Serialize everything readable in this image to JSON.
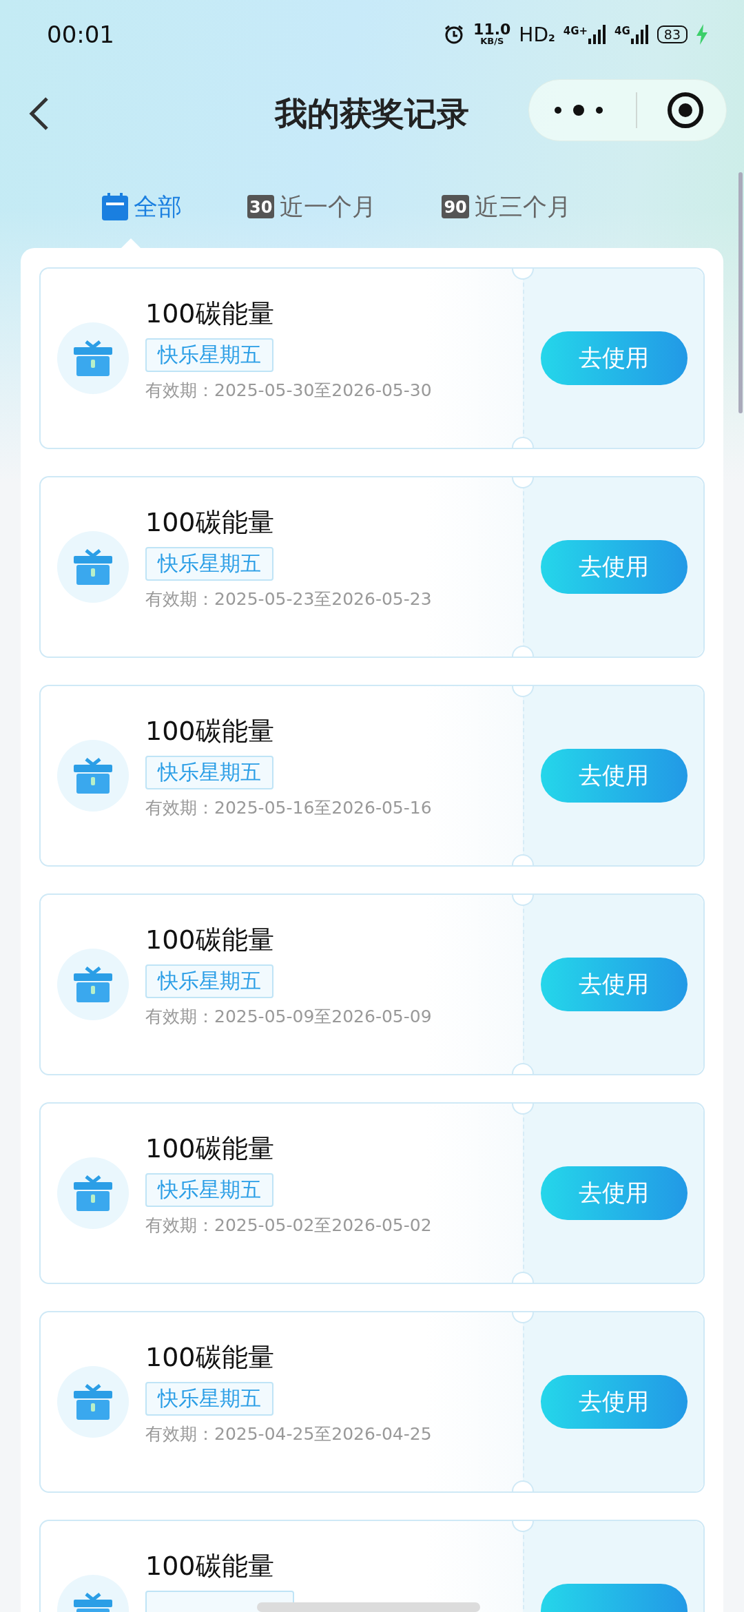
{
  "status_bar": {
    "time": "00:01",
    "speed": "11.0",
    "speed_unit": "KB/S",
    "hd": "HD",
    "sim": "2",
    "signals": [
      "4G+",
      "4G"
    ],
    "battery": "83",
    "charging": true
  },
  "header": {
    "title": "我的获奖记录"
  },
  "tabs": [
    {
      "label": "全部",
      "selected": true
    },
    {
      "label": "近一个月",
      "badge": "30",
      "selected": false
    },
    {
      "label": "近三个月",
      "badge": "90",
      "selected": false
    }
  ],
  "records": [
    {
      "title": "100碳能量",
      "tag": "快乐星期五",
      "validity": "有效期：2025-05-30至2026-05-30",
      "button": "去使用"
    },
    {
      "title": "100碳能量",
      "tag": "快乐星期五",
      "validity": "有效期：2025-05-23至2026-05-23",
      "button": "去使用"
    },
    {
      "title": "100碳能量",
      "tag": "快乐星期五",
      "validity": "有效期：2025-05-16至2026-05-16",
      "button": "去使用"
    },
    {
      "title": "100碳能量",
      "tag": "快乐星期五",
      "validity": "有效期：2025-05-09至2026-05-09",
      "button": "去使用"
    },
    {
      "title": "100碳能量",
      "tag": "快乐星期五",
      "validity": "有效期：2025-05-02至2026-05-02",
      "button": "去使用"
    },
    {
      "title": "100碳能量",
      "tag": "快乐星期五",
      "validity": "有效期：2025-04-25至2026-04-25",
      "button": "去使用"
    },
    {
      "title": "100碳能量"
    }
  ]
}
